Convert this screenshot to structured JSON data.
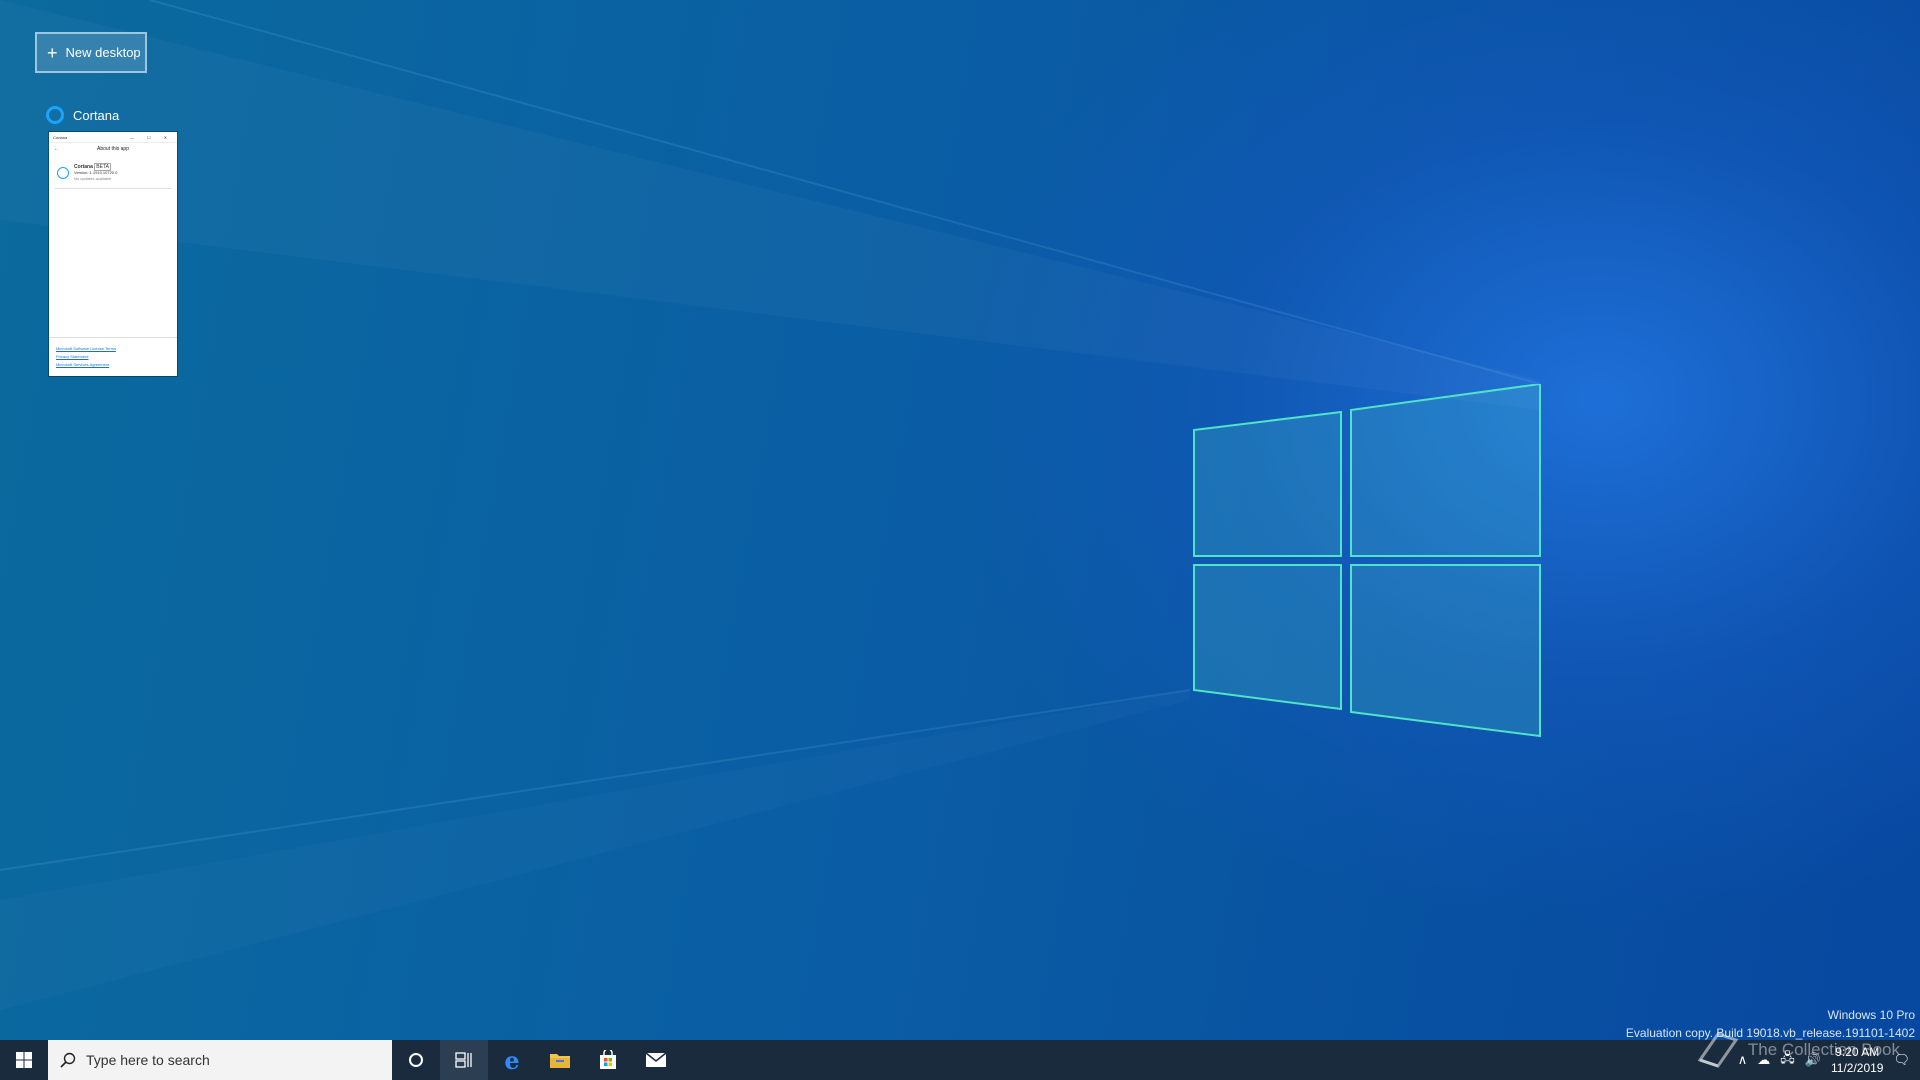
{
  "task_view": {
    "new_desktop_label": "New desktop",
    "new_desktop_icon": "plus-icon",
    "window": {
      "title": "Cortana",
      "app_icon": "cortana-ring-icon",
      "thumbnail": {
        "titlebar": "Cortana",
        "titlebar_controls": "— ☐ ✕",
        "back": "←",
        "heading": "About this app",
        "app_name": "Cortana",
        "badge": "BETA",
        "version": "Version: 1.1910.10720.0",
        "status": "No updates available",
        "links": [
          "Microsoft Software License Terms",
          "Privacy Statement",
          "Microsoft Services Agreement"
        ]
      }
    }
  },
  "watermark": {
    "edition": "Windows 10 Pro",
    "build": "Evaluation copy. Build 19018.vb_release.191101-1402"
  },
  "overlay": {
    "collection_text": "The Collection Book"
  },
  "taskbar": {
    "start_icon": "windows-logo-icon",
    "search_placeholder": "Type here to search",
    "cortana_icon": "cortana-circle-icon",
    "task_view_icon": "task-view-icon",
    "pinned": [
      {
        "name": "edge-icon",
        "color": "#1e90ff"
      },
      {
        "name": "file-explorer-icon",
        "color": "#f2c44b"
      },
      {
        "name": "store-icon",
        "color": "#ffffff"
      },
      {
        "name": "mail-icon",
        "color": "#ffffff"
      }
    ],
    "tray": {
      "time": "9:20 AM",
      "date": "11/2/2019"
    }
  },
  "colors": {
    "accent": "#1aa3ff",
    "taskbar": "#1b2b3e"
  }
}
